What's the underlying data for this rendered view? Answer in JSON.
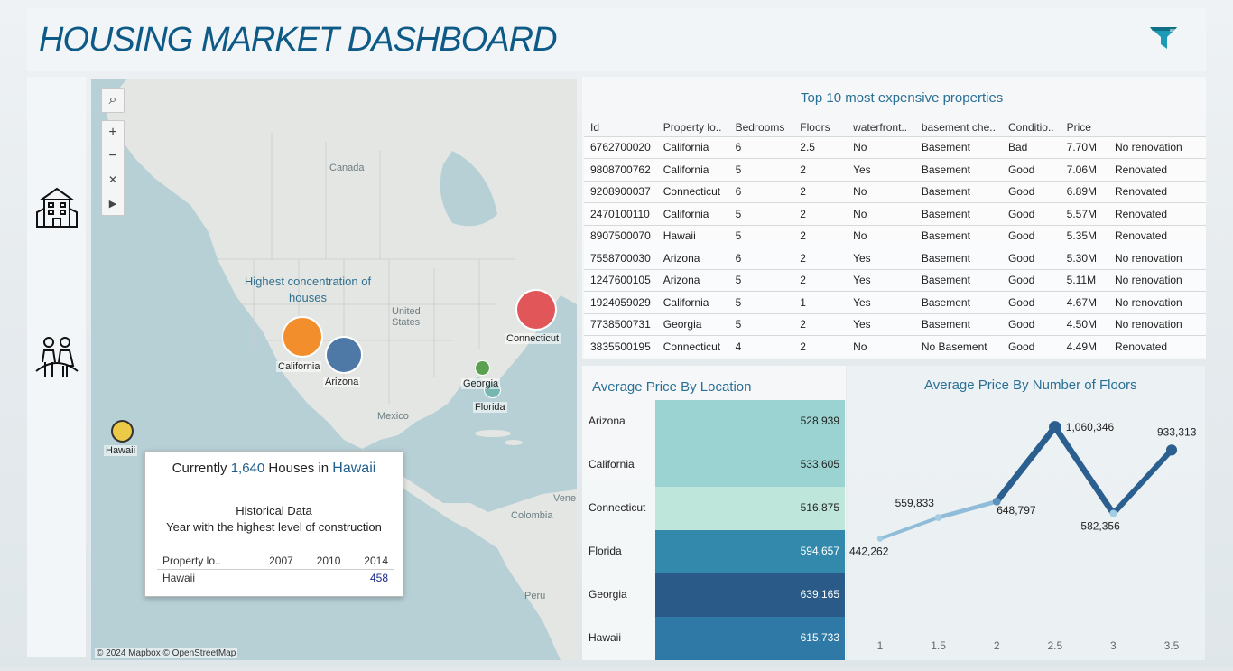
{
  "header": {
    "title": "HOUSING MARKET DASHBOARD"
  },
  "icons": {
    "filter": "filter-icon",
    "rail_top": "apartment-building-icon",
    "rail_bottom": "couple-people-icon"
  },
  "map": {
    "country_labels": [
      "Canada",
      "United States",
      "Mexico",
      "Colombia",
      "Peru",
      "Vene"
    ],
    "annotation": "Highest concentration of houses",
    "attribution": "© 2024 Mapbox © OpenStreetMap",
    "locations": [
      {
        "name": "California",
        "color": "#f28e2b"
      },
      {
        "name": "Arizona",
        "color": "#4e79a7"
      },
      {
        "name": "Connecticut",
        "color": "#e15759"
      },
      {
        "name": "Georgia",
        "color": "#59a14f"
      },
      {
        "name": "Florida",
        "color": "#76b7b2"
      },
      {
        "name": "Hawaii",
        "color": "#edc948"
      }
    ],
    "tooltip": {
      "prefix": "Currently",
      "count": "1,640",
      "mid": "Houses in",
      "place": "Hawaii",
      "line1": "Historical Data",
      "line2": "Year with the highest level of construction",
      "columns": [
        "Property lo..",
        "2007",
        "2010",
        "2014"
      ],
      "row": [
        "Hawaii",
        "",
        "",
        "458"
      ]
    }
  },
  "top10": {
    "title": "Top 10 most expensive properties",
    "columns": [
      "Id",
      "Property lo..",
      "Bedrooms",
      "Floors",
      "waterfront..",
      "basement che..",
      "Conditio..",
      "Price",
      ""
    ],
    "rows": [
      [
        "6762700020",
        "California",
        "6",
        "2.5",
        "No",
        "Basement",
        "Bad",
        "7.70M",
        "No renovation"
      ],
      [
        "9808700762",
        "California",
        "5",
        "2",
        "Yes",
        "Basement",
        "Good",
        "7.06M",
        "Renovated"
      ],
      [
        "9208900037",
        "Connecticut",
        "6",
        "2",
        "No",
        "Basement",
        "Good",
        "6.89M",
        "Renovated"
      ],
      [
        "2470100110",
        "California",
        "5",
        "2",
        "No",
        "Basement",
        "Good",
        "5.57M",
        "Renovated"
      ],
      [
        "8907500070",
        "Hawaii",
        "5",
        "2",
        "No",
        "Basement",
        "Good",
        "5.35M",
        "Renovated"
      ],
      [
        "7558700030",
        "Arizona",
        "6",
        "2",
        "Yes",
        "Basement",
        "Good",
        "5.30M",
        "No renovation"
      ],
      [
        "1247600105",
        "Arizona",
        "5",
        "2",
        "Yes",
        "Basement",
        "Good",
        "5.11M",
        "No renovation"
      ],
      [
        "1924059029",
        "California",
        "5",
        "1",
        "Yes",
        "Basement",
        "Good",
        "4.67M",
        "No renovation"
      ],
      [
        "7738500731",
        "Georgia",
        "5",
        "2",
        "Yes",
        "Basement",
        "Good",
        "4.50M",
        "No renovation"
      ],
      [
        "3835500195",
        "Connecticut",
        "4",
        "2",
        "No",
        "No Basement",
        "Good",
        "4.49M",
        "Renovated"
      ]
    ]
  },
  "chart_data": [
    {
      "type": "table",
      "title": "Average Price By Location",
      "categories": [
        "Arizona",
        "California",
        "Connecticut",
        "Florida",
        "Georgia",
        "Hawaii"
      ],
      "values": [
        528939,
        533605,
        516875,
        594657,
        639165,
        615733
      ],
      "labels": [
        "528,939",
        "533,605",
        "516,875",
        "594,657",
        "639,165",
        "615,733"
      ],
      "colors": [
        "#9bd3d2",
        "#9bd3d2",
        "#bfe6db",
        "#3389ac",
        "#2a5b88",
        "#2f79a6"
      ]
    },
    {
      "type": "line",
      "title": "Average Price By Number of Floors",
      "x": [
        1,
        1.5,
        2,
        2.5,
        3,
        3.5
      ],
      "x_labels": [
        "1",
        "1.5",
        "2",
        "2.5",
        "3",
        "3.5"
      ],
      "values": [
        442262,
        559833,
        648797,
        1060346,
        582356,
        933313
      ],
      "labels": [
        "442,262",
        "559,833",
        "648,797",
        "1,060,346",
        "582,356",
        "933,313"
      ],
      "ylim": [
        400000,
        1100000
      ]
    }
  ]
}
